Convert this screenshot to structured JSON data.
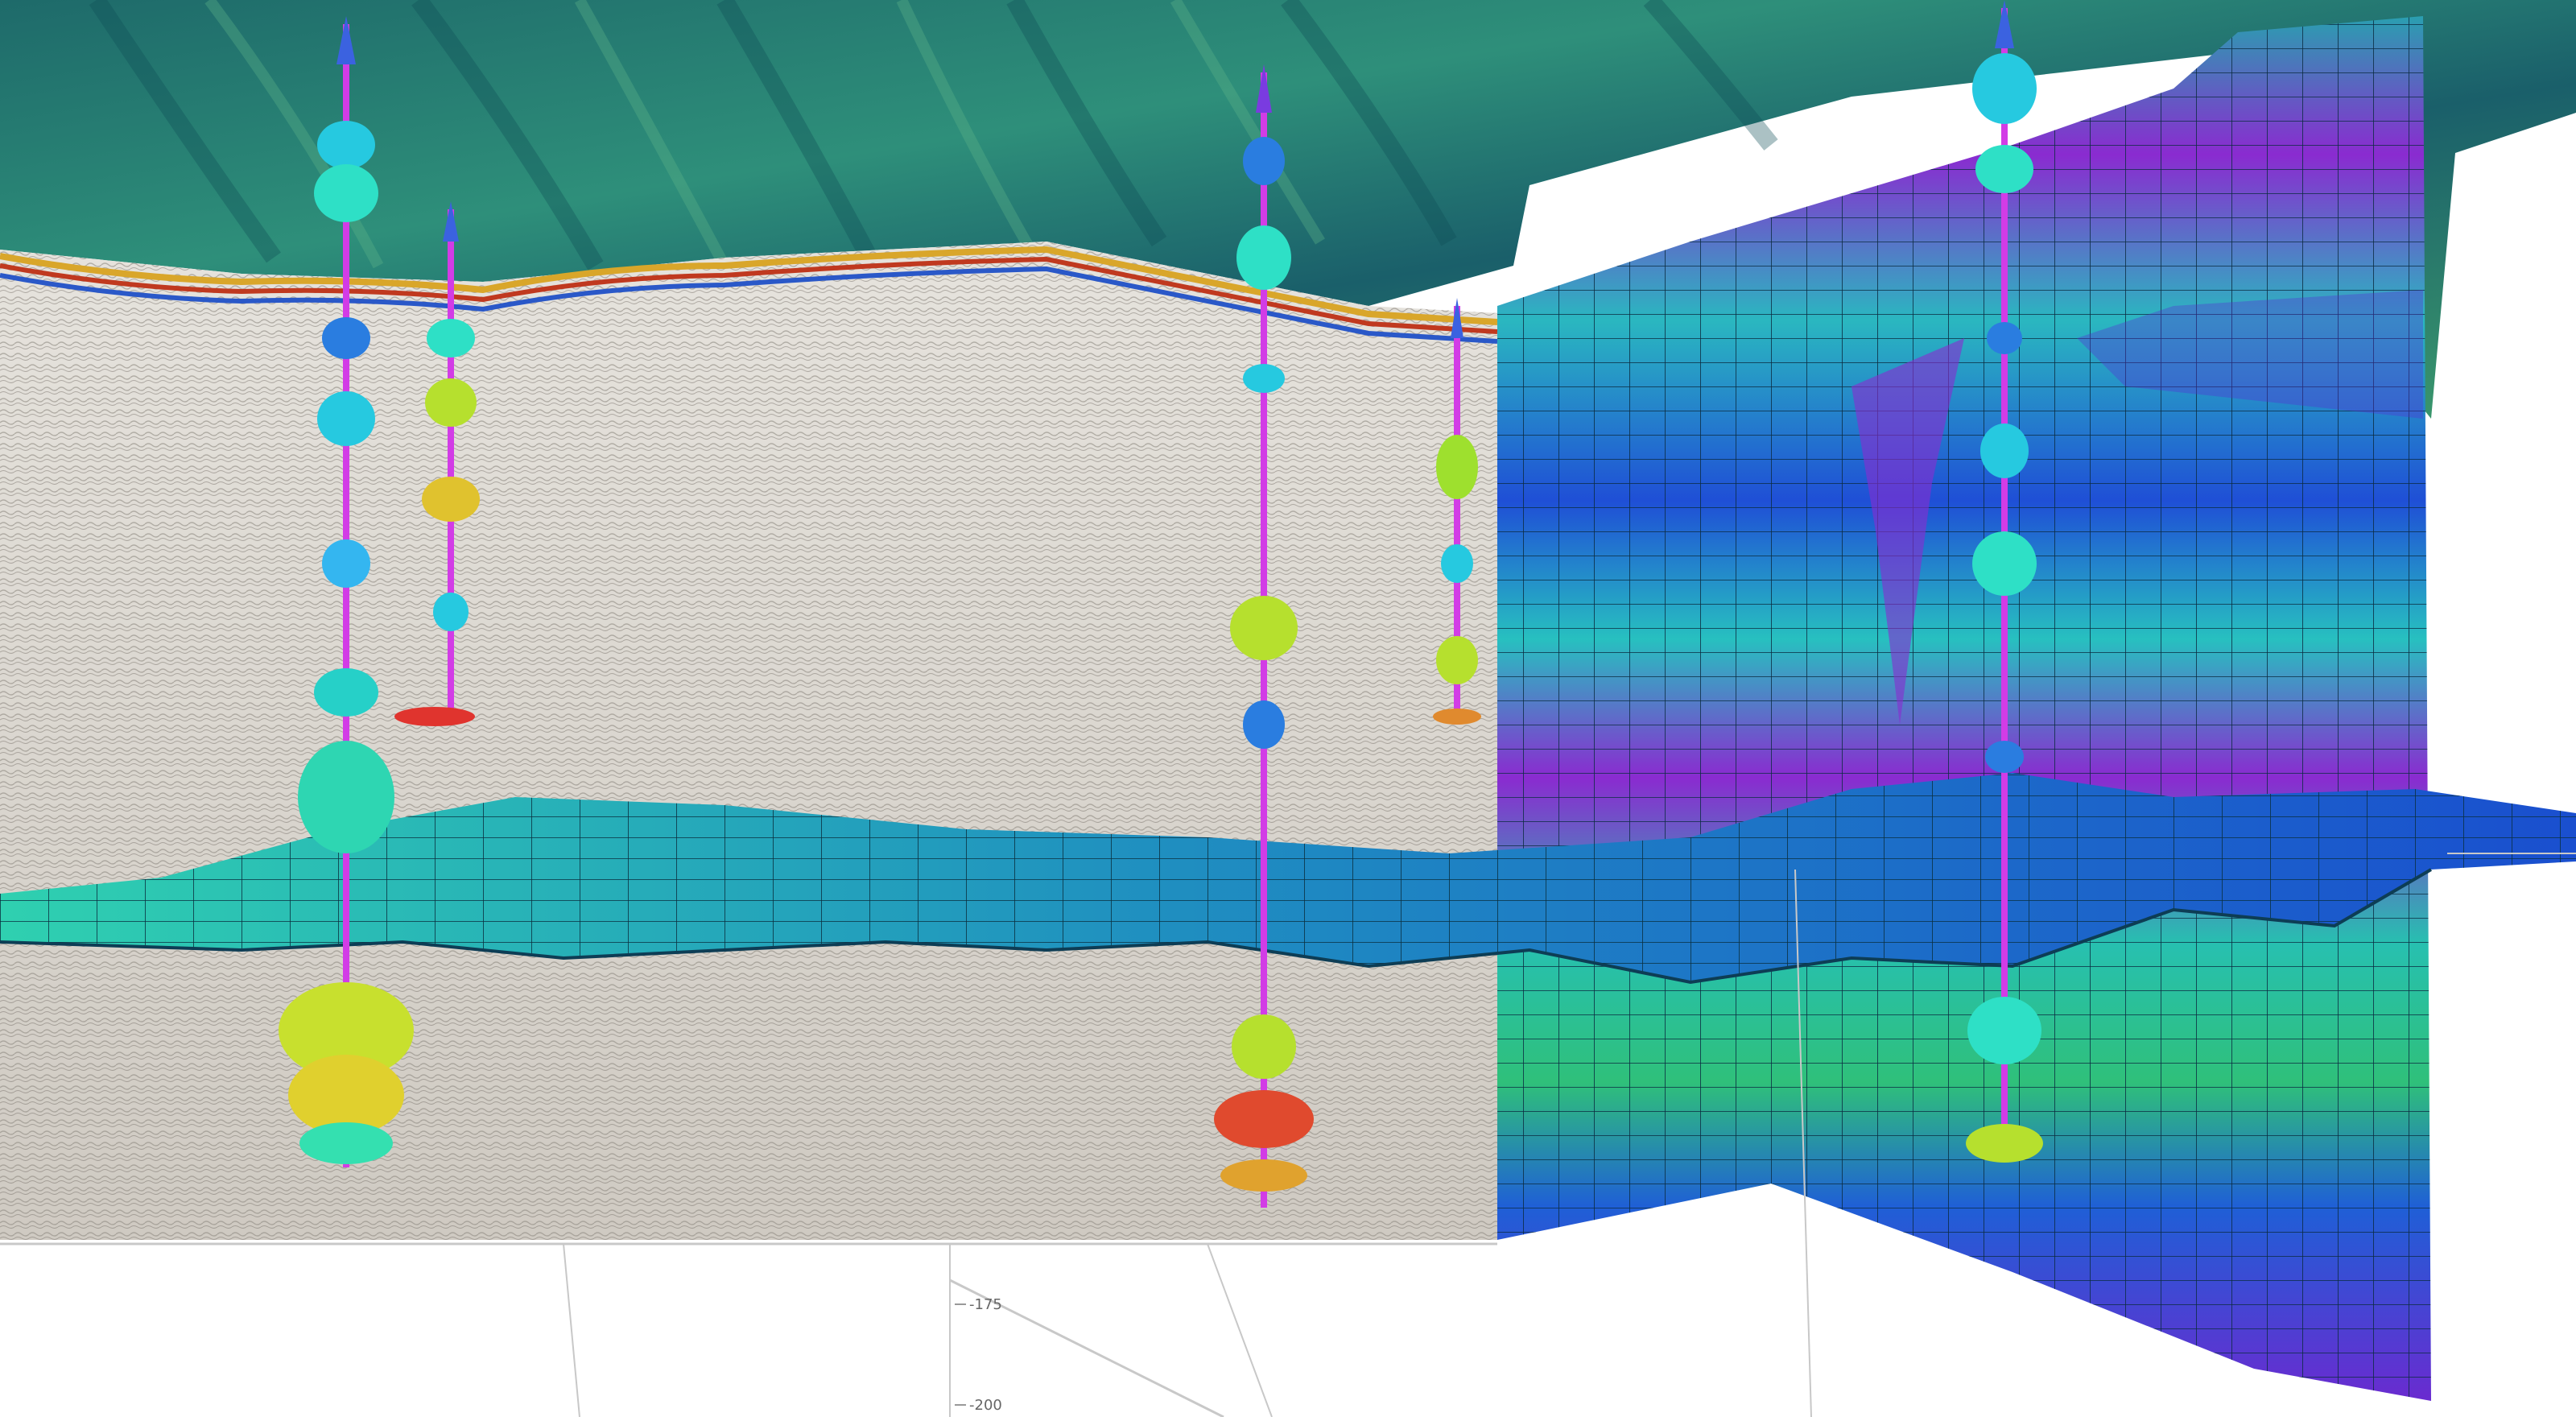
{
  "viewport": {
    "axis_ticks": [
      "-175",
      "-200"
    ]
  },
  "colors": {
    "background": "#ffffff",
    "terrain_dark": "#1b5b66",
    "terrain_light": "#3f9a72",
    "seismic_base": "#d8d5ce",
    "grid_violet": "#8a2bd0",
    "grid_blue": "#1f4fd6",
    "grid_cyan": "#27c0c0",
    "horizon_teal": "#2fc6a8",
    "horizon_blue": "#1a5fd2",
    "well_core": "#d23ce6"
  },
  "layers": {
    "terrain": "terrain-surface",
    "seismic": "seismic-section",
    "grid": "reservoir-grid-panel",
    "horizon": "horizon-surface",
    "wells": "well-log-tubes"
  }
}
